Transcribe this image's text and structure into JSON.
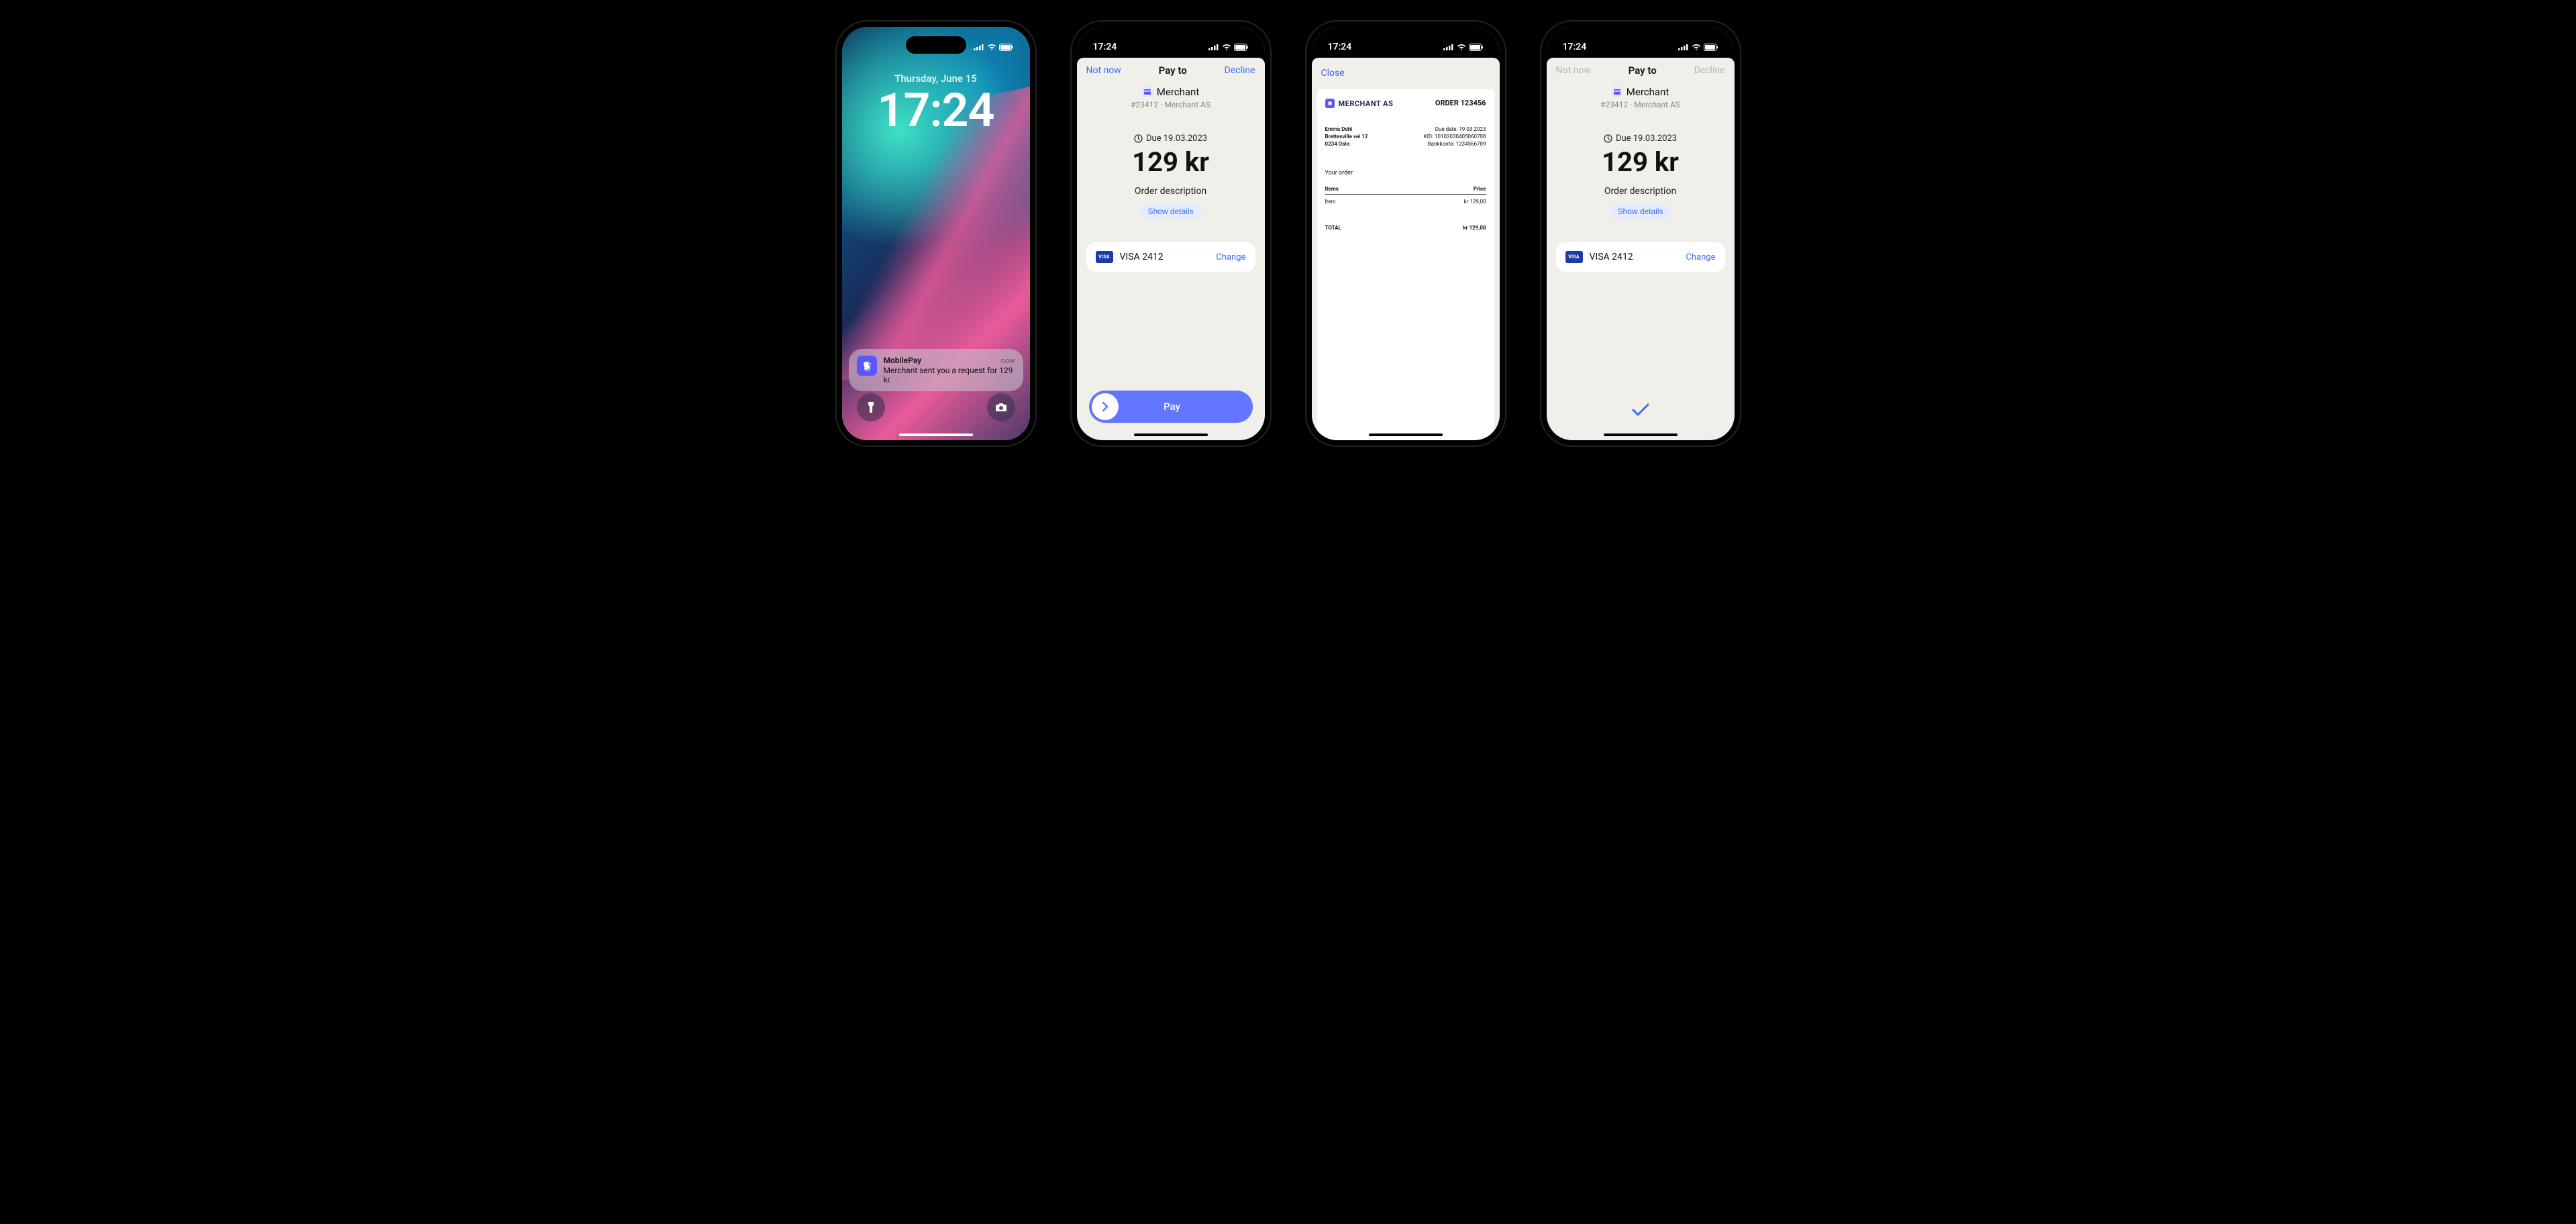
{
  "status": {
    "time": "17:24"
  },
  "lock": {
    "date": "Thursday, June 15",
    "time": "17:24",
    "notification": {
      "app": "MobilePay",
      "when": "now",
      "message": "Merchant sent you a request for 129 kr."
    }
  },
  "pay": {
    "header": {
      "left": "Not now",
      "title": "Pay to",
      "right": "Decline"
    },
    "merchant": {
      "name": "Merchant",
      "sub": "#23412 · Merchant AS"
    },
    "due_label": "Due 19.03.2023",
    "amount": "129 kr",
    "description": "Order description",
    "show_details": "Show details",
    "card": {
      "brand": "VISA",
      "label": "VISA 2412",
      "change": "Change"
    },
    "swipe_label": "Pay"
  },
  "invoice_sheet": {
    "close": "Close"
  },
  "invoice": {
    "merchant": "MERCHANT AS",
    "order": "ORDER 123456",
    "customer": {
      "name": "Emma Dahl",
      "street": "Brettesville vei 12",
      "city": "0234 Oslo"
    },
    "meta": {
      "due": "Due date: 19.03.2023",
      "kid": "KID: 10102030405060708",
      "account": "Bankkonto: 1234566789"
    },
    "section_title": "Your order",
    "columns": {
      "item": "Items",
      "price": "Price"
    },
    "row": {
      "item": "Item",
      "price": "kr 129,00"
    },
    "total": {
      "label": "TOTAL",
      "value": "kr 129,00"
    }
  }
}
